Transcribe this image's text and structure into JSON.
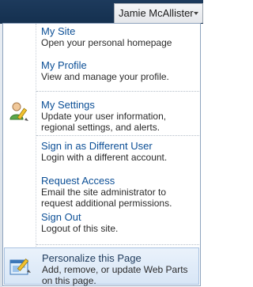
{
  "header": {
    "user_name": "Jamie McAllister"
  },
  "menu": {
    "items": [
      {
        "title": "My Site",
        "description": "Open your personal homepage"
      },
      {
        "title": "My Profile",
        "description": "View and manage your profile."
      },
      {
        "title": "My Settings",
        "description": "Update your user information, regional settings, and alerts.",
        "icon": "user-settings-icon"
      },
      {
        "title": "Sign in as Different User",
        "description": "Login with a different account."
      },
      {
        "title": "Request Access",
        "description": "Email the site administrator to request additional permissions."
      },
      {
        "title": "Sign Out",
        "description": "Logout of this site."
      },
      {
        "title": "Personalize this Page",
        "description": "Add, remove, or update Web Parts on this page.",
        "icon": "personalize-page-icon"
      }
    ]
  },
  "colors": {
    "link": "#0c4f96",
    "menu_border": "#8ea3bd",
    "highlight_bg": "#d8e6f6"
  }
}
